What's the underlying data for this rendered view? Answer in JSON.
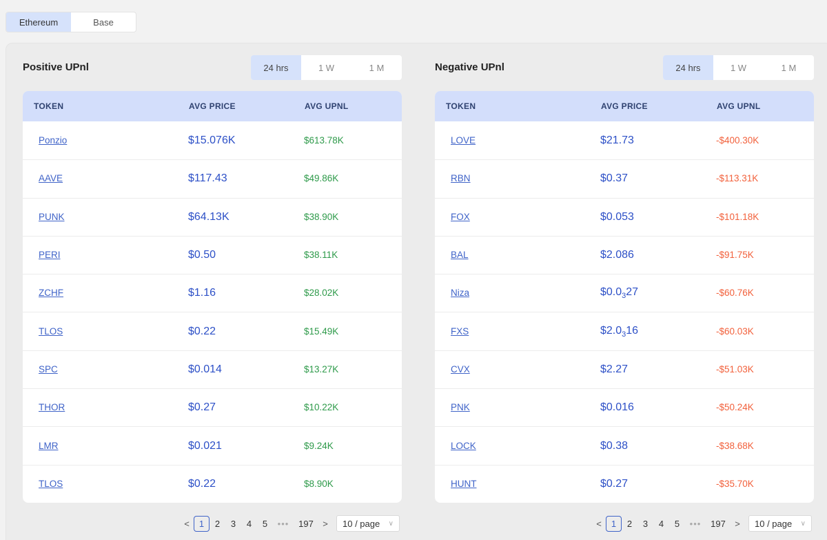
{
  "chain_tabs": [
    {
      "label": "Ethereum",
      "active": true
    },
    {
      "label": "Base",
      "active": false
    }
  ],
  "columns": {
    "token": "TOKEN",
    "avg_price": "AVG PRICE",
    "avg_upnl": "AVG UPNL"
  },
  "range_tabs": [
    "24 hrs",
    "1 W",
    "1 M"
  ],
  "positive": {
    "title": "Positive UPnl",
    "rows": [
      {
        "token": "Ponzio",
        "price": "$15.076K",
        "upnl": "$613.78K"
      },
      {
        "token": "AAVE",
        "price": "$117.43",
        "upnl": "$49.86K"
      },
      {
        "token": "PUNK",
        "price": "$64.13K",
        "upnl": "$38.90K"
      },
      {
        "token": "PERI",
        "price": "$0.50",
        "upnl": "$38.11K"
      },
      {
        "token": "ZCHF",
        "price": "$1.16",
        "upnl": "$28.02K"
      },
      {
        "token": "TLOS",
        "price": "$0.22",
        "upnl": "$15.49K"
      },
      {
        "token": "SPC",
        "price": "$0.014",
        "upnl": "$13.27K"
      },
      {
        "token": "THOR",
        "price": "$0.27",
        "upnl": "$10.22K"
      },
      {
        "token": "LMR",
        "price": "$0.021",
        "upnl": "$9.24K"
      },
      {
        "token": "TLOS",
        "price": "$0.22",
        "upnl": "$8.90K"
      }
    ]
  },
  "negative": {
    "title": "Negative UPnl",
    "rows": [
      {
        "token": "LOVE",
        "price": "$21.73",
        "upnl": "-$400.30K"
      },
      {
        "token": "RBN",
        "price": "$0.37",
        "upnl": "-$113.31K"
      },
      {
        "token": "FOX",
        "price": "$0.053",
        "upnl": "-$101.18K"
      },
      {
        "token": "BAL",
        "price": "$2.086",
        "upnl": "-$91.75K"
      },
      {
        "token": "Niza",
        "price_pre": "$0.0",
        "price_sub": "3",
        "price_post": "27",
        "upnl": "-$60.76K"
      },
      {
        "token": "FXS",
        "price_pre": "$2.0",
        "price_sub": "3",
        "price_post": "16",
        "upnl": "-$60.03K"
      },
      {
        "token": "CVX",
        "price": "$2.27",
        "upnl": "-$51.03K"
      },
      {
        "token": "PNK",
        "price": "$0.016",
        "upnl": "-$50.24K"
      },
      {
        "token": "LOCK",
        "price": "$0.38",
        "upnl": "-$38.68K"
      },
      {
        "token": "HUNT",
        "price": "$0.27",
        "upnl": "-$35.70K"
      }
    ]
  },
  "pagination": {
    "prev": "<",
    "next": ">",
    "pages": [
      "1",
      "2",
      "3",
      "4",
      "5"
    ],
    "dots": "•••",
    "last": "197",
    "current": "1",
    "page_size": "10 / page"
  }
}
